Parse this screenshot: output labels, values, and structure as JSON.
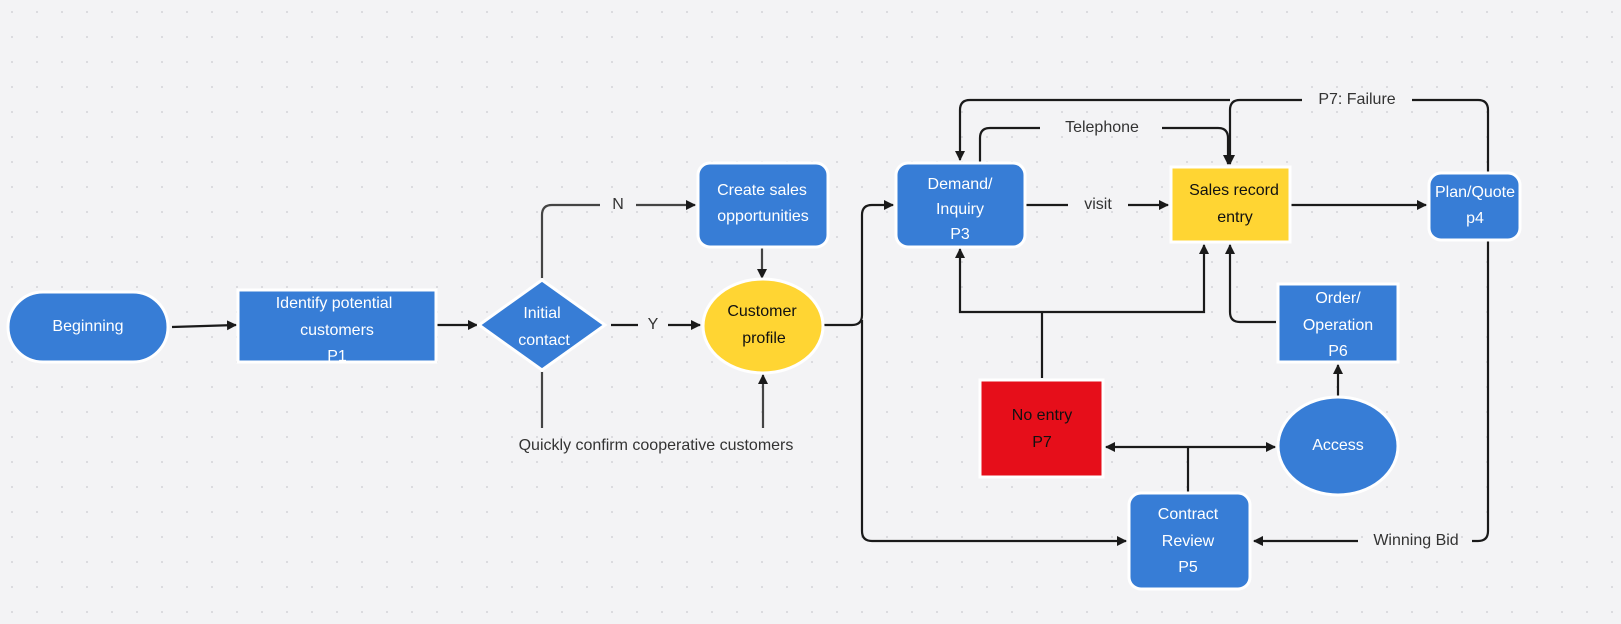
{
  "colors": {
    "blue": "#377dd6",
    "yellow": "#ffd533",
    "red": "#e60e1a",
    "edge": "#1a1a1a"
  },
  "nodes": {
    "beginning": {
      "lines": [
        "Beginning"
      ]
    },
    "identify": {
      "lines": [
        "Identify potential",
        "customers",
        "P1"
      ]
    },
    "initial_contact": {
      "lines": [
        "Initial",
        "contact"
      ]
    },
    "create_sales": {
      "lines": [
        "Create sales",
        "opportunities"
      ]
    },
    "customer_profile": {
      "lines": [
        "Customer",
        "profile"
      ]
    },
    "demand": {
      "lines": [
        "Demand/",
        "Inquiry",
        "P3"
      ]
    },
    "sales_record": {
      "lines": [
        "Sales record",
        "entry"
      ]
    },
    "plan_quote": {
      "lines": [
        "Plan/Quote",
        "p4"
      ]
    },
    "order_operation": {
      "lines": [
        "Order/",
        "Operation",
        "P6"
      ]
    },
    "no_entry": {
      "lines": [
        "No entry",
        "P7"
      ]
    },
    "access": {
      "lines": [
        "Access"
      ]
    },
    "contract_review": {
      "lines": [
        "Contract",
        "Review",
        "P5"
      ]
    }
  },
  "edge_labels": {
    "n": "N",
    "y": "Y",
    "quick": "Quickly confirm cooperative customers",
    "visit": "visit",
    "telephone": "Telephone",
    "failure": "P7: Failure",
    "winning": "Winning Bid"
  }
}
